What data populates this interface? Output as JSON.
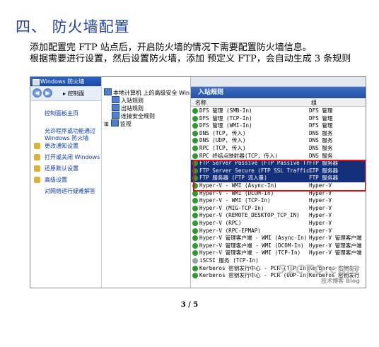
{
  "heading": "四、 防火墙配置",
  "paragraph1": "添加配置完 FTP 站点后，开启防火墙的情况下需要配置防火墙信息。",
  "paragraph2": "根据需要进行设置，然后设置防火墙，添加 预定义 FTP，会自动生成 3 条规则",
  "screenshot": {
    "window_title": "Windows 防火墙",
    "address_text": "▸ 控制面",
    "left_links": [
      "控制面板主页",
      "允许程序或功能通过 Windows 防火墙",
      "更改通知设置",
      "打开或关闭 Windows 防",
      "还原默认设置",
      "高级设置",
      "对网络进行疑难解答"
    ],
    "tree": {
      "root": "本地计算机 上的高级安全 Win",
      "inbound": "入站规则",
      "outbound": "出站规则",
      "connection": "连接安全规则",
      "monitor": "监视"
    },
    "panel_title": "入站规则",
    "col_name": "名称",
    "col_group": "组",
    "rules": [
      {
        "name": "DFS 管理 (SMB-In)",
        "group": "DFS 管理",
        "grey": false,
        "selected": false
      },
      {
        "name": "DFS 管理 (TCP-In)",
        "group": "DFS 管理",
        "grey": false,
        "selected": false
      },
      {
        "name": "DFS 管理 (WMI-In)",
        "group": "DFS 管理",
        "grey": false,
        "selected": false
      },
      {
        "name": "DNS (TCP, 传入)",
        "group": "DNS 服务",
        "grey": false,
        "selected": false
      },
      {
        "name": "DNS (UDP, 传入)",
        "group": "DNS 服务",
        "grey": false,
        "selected": false
      },
      {
        "name": "RPC (TCP, 传入)",
        "group": "DNS 服务",
        "grey": false,
        "selected": false
      },
      {
        "name": "RPC 终结点映射器(TCP, 传入)",
        "group": "DNS 服务",
        "grey": false,
        "selected": false
      },
      {
        "name": "FTP Server Passive (FTP Passive Tr",
        "group": "FTP 服务器",
        "grey": false,
        "selected": true
      },
      {
        "name": "FTP Server Secure (FTP SSL Traffic…",
        "group": "FTP 服务器",
        "grey": false,
        "selected": true
      },
      {
        "name": "FTP 服务器 (FTP 流入量)",
        "group": "FTP 服务器",
        "grey": false,
        "selected": true
      },
      {
        "name": "Hyper-V - WMI (Async-In)",
        "group": "Hyper-V",
        "grey": false,
        "selected": false
      },
      {
        "name": "Hyper-V - WMI (DCOM-In)",
        "group": "Hyper-V",
        "grey": false,
        "selected": false
      },
      {
        "name": "Hyper-V - WMI (TCP-In)",
        "group": "Hyper-V",
        "grey": false,
        "selected": false
      },
      {
        "name": "Hyper-V (MIG-TCP-In)",
        "group": "Hyper-V",
        "grey": false,
        "selected": false
      },
      {
        "name": "Hyper-V (REMOTE_DESKTOP_TCP_IN)",
        "group": "Hyper-V",
        "grey": false,
        "selected": false
      },
      {
        "name": "Hyper-V (RPC)",
        "group": "Hyper-V",
        "grey": false,
        "selected": false
      },
      {
        "name": "Hyper-V (RPC-EPMAP)",
        "group": "Hyper-V",
        "grey": false,
        "selected": false
      },
      {
        "name": "Hyper-V 管理客户端 - WMI (Async-In)",
        "group": "Hyper-V 管理客户端",
        "grey": false,
        "selected": false
      },
      {
        "name": "Hyper-V 管理客户端 - WMI (DCOM-In)",
        "group": "Hyper-V 管理客户端",
        "grey": false,
        "selected": false
      },
      {
        "name": "Hyper-V 管理客户端 - WMI (TCP-In)",
        "group": "Hyper-V 管理客户端",
        "grey": false,
        "selected": false
      },
      {
        "name": "iSCSI 服务 (TCP-In)",
        "group": "",
        "grey": true,
        "selected": false
      },
      {
        "name": "Kerberos 密钥发行中心 - PCR (TCP-In)",
        "group": "Kerberos 密钥发行",
        "grey": false,
        "selected": false
      },
      {
        "name": "Kerberos 密钥发行中心 - PCR (UDP-In)",
        "group": "Kerberos 密钥发行",
        "grey": false,
        "selected": false
      }
    ],
    "watermark_main": "51CTO.com",
    "watermark_sub": "技术博客 Blog"
  },
  "page_number": "3 / 5",
  "colors": {
    "heading": "#1f3fa0",
    "selection": "#15307a",
    "highlight_box": "#e01010"
  }
}
